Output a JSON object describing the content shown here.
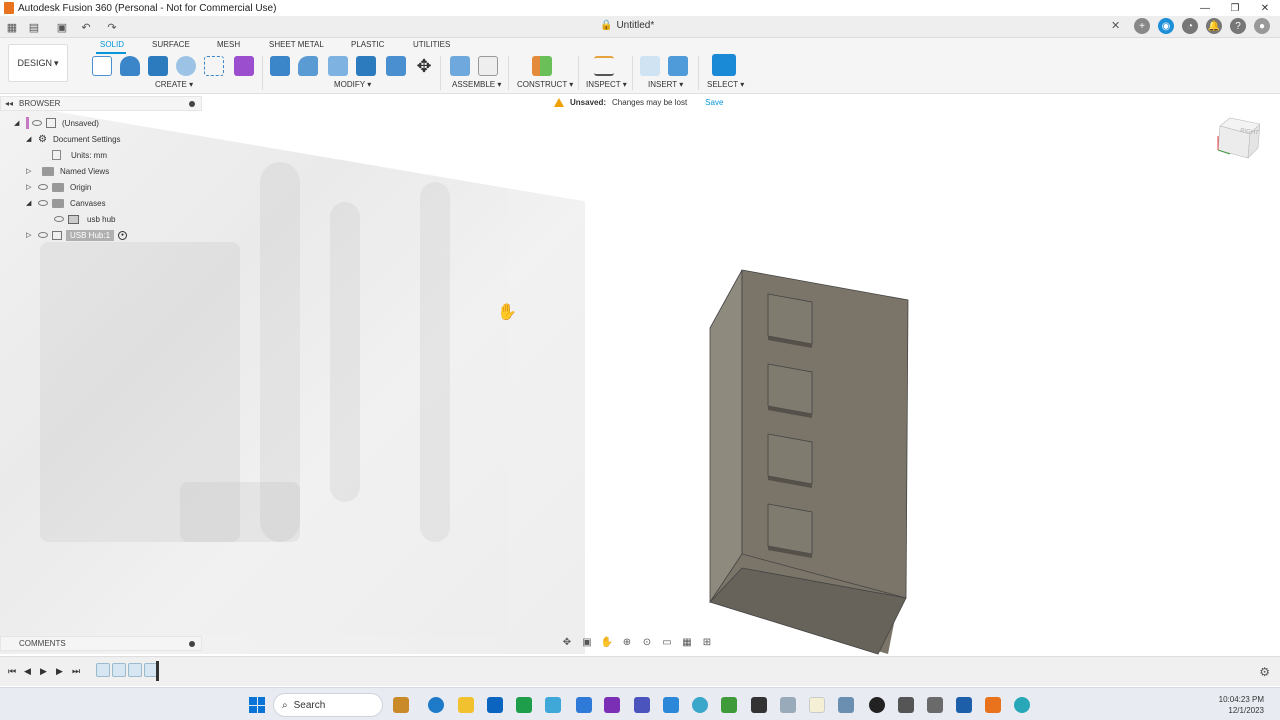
{
  "window": {
    "title": "Autodesk Fusion 360 (Personal - Not for Commercial Use)",
    "controls": [
      "—",
      "❐",
      "✕"
    ]
  },
  "doc": {
    "tab_title": "Untitled*",
    "close": "✕"
  },
  "ribbon": {
    "design_label": "DESIGN",
    "tabs": [
      "SOLID",
      "SURFACE",
      "MESH",
      "SHEET METAL",
      "PLASTIC",
      "UTILITIES"
    ],
    "active_tab": "SOLID",
    "groups": {
      "create": "CREATE",
      "modify": "MODIFY",
      "assemble": "ASSEMBLE",
      "construct": "CONSTRUCT",
      "inspect": "INSPECT",
      "insert": "INSERT",
      "select": "SELECT"
    }
  },
  "browser": {
    "header": "BROWSER",
    "items": [
      {
        "label": "(Unsaved)"
      },
      {
        "label": "Document Settings"
      },
      {
        "label": "Units: mm"
      },
      {
        "label": "Named Views"
      },
      {
        "label": "Origin"
      },
      {
        "label": "Canvases"
      },
      {
        "label": "usb hub"
      },
      {
        "label": "USB Hub:1"
      }
    ]
  },
  "unsaved_bar": {
    "label": "Unsaved:",
    "message": "Changes may be lost",
    "save": "Save"
  },
  "viewcube": {
    "face": "RIGHT"
  },
  "comments": {
    "header": "COMMENTS"
  },
  "taskbar": {
    "search_placeholder": "Search",
    "time": "10:04:23 PM",
    "date": "12/1/2023"
  },
  "colors": {
    "accent": "#0696d7",
    "model_front": "#7a7568",
    "model_side": "#8f8a7e",
    "model_top": "#9a958a",
    "model_bottom": "#67635a"
  }
}
